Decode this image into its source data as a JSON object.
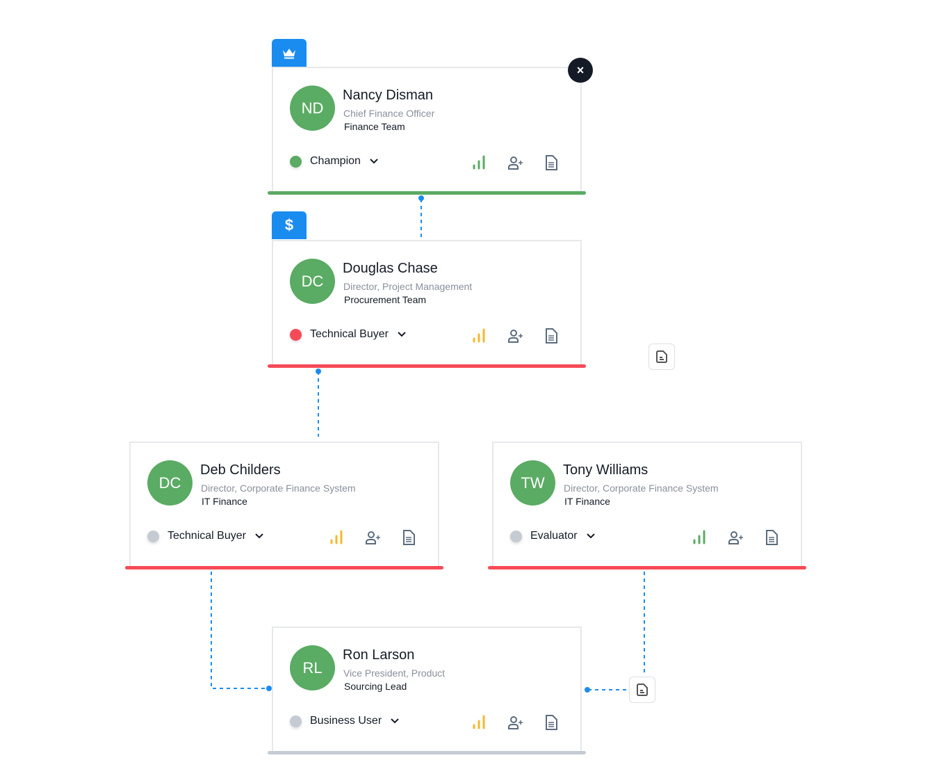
{
  "colors": {
    "accent": "#1a8cf0",
    "champion": "#5aab63",
    "technical_buyer": "#f64a57",
    "neutral": "#c5cbd3",
    "signal_green": "#5aab63",
    "signal_yellow": "#f5b82e"
  },
  "close_label": "×",
  "dollar_label": "$",
  "cards": [
    {
      "initials": "ND",
      "name": "Nancy Disman",
      "title": "Chief Finance Officer",
      "team": "Finance Team",
      "role": "Champion",
      "status": "champion",
      "signal": "green",
      "badge": "crown-icon"
    },
    {
      "initials": "DC",
      "name": "Douglas Chase",
      "title": "Director, Project Management",
      "team": "Procurement Team",
      "role": "Technical Buyer",
      "status": "technical_buyer",
      "signal": "yellow",
      "badge": "dollar-icon"
    },
    {
      "initials": "DC",
      "name": "Deb Childers",
      "title": "Director, Corporate Finance System",
      "team": "IT Finance",
      "role": "Technical Buyer",
      "status": "neutral",
      "signal": "yellow"
    },
    {
      "initials": "TW",
      "name": "Tony Williams",
      "title": "Director, Corporate Finance System",
      "team": "IT Finance",
      "role": "Evaluator",
      "status": "neutral",
      "signal": "green"
    },
    {
      "initials": "RL",
      "name": "Ron Larson",
      "title": "Vice President, Product",
      "team": "Sourcing Lead",
      "role": "Business User",
      "status": "neutral",
      "signal": "yellow"
    }
  ]
}
